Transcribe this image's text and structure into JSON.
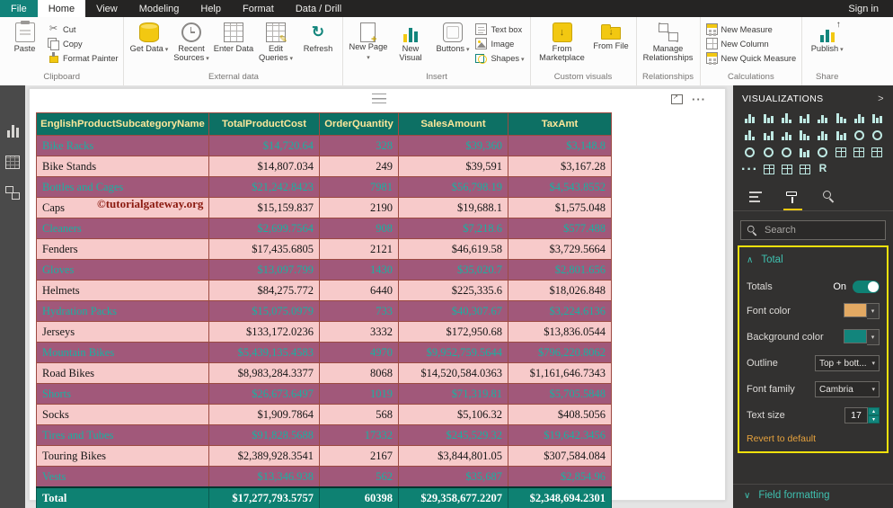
{
  "titlebar": {
    "file_tab": "File",
    "tabs": [
      "Home",
      "View",
      "Modeling",
      "Help",
      "Format",
      "Data / Drill"
    ],
    "active_tab": "Home",
    "sign_in": "Sign in"
  },
  "ribbon": {
    "groups": {
      "clipboard": {
        "label": "Clipboard",
        "paste": "Paste",
        "cut": "Cut",
        "copy": "Copy",
        "format_painter": "Format Painter"
      },
      "external_data": {
        "label": "External data",
        "get_data": "Get Data",
        "recent_sources": "Recent Sources",
        "enter_data": "Enter Data",
        "edit_queries": "Edit Queries",
        "refresh": "Refresh"
      },
      "insert": {
        "label": "Insert",
        "new_page": "New Page",
        "new_visual": "New Visual",
        "buttons": "Buttons",
        "text_box": "Text box",
        "image": "Image",
        "shapes": "Shapes"
      },
      "custom_visuals": {
        "label": "Custom visuals",
        "from_marketplace": "From Marketplace",
        "from_file": "From File"
      },
      "relationships": {
        "label": "Relationships",
        "manage_relationships": "Manage Relationships"
      },
      "calculations": {
        "label": "Calculations",
        "new_measure": "New Measure",
        "new_column": "New Column",
        "new_quick_measure": "New Quick Measure"
      },
      "share": {
        "label": "Share",
        "publish": "Publish"
      }
    }
  },
  "canvas": {
    "watermark": "©tutorialgateway.org"
  },
  "table": {
    "columns": [
      "EnglishProductSubcategoryName",
      "TotalProductCost",
      "OrderQuantity",
      "SalesAmount",
      "TaxAmt"
    ],
    "rows": [
      {
        "style": "accent",
        "cells": [
          "Bike Racks",
          "$14,720.64",
          "328",
          "$39,360",
          "$3,148.8"
        ]
      },
      {
        "style": "plain",
        "cells": [
          "Bike Stands",
          "$14,807.034",
          "249",
          "$39,591",
          "$3,167.28"
        ]
      },
      {
        "style": "accent",
        "cells": [
          "Bottles and Cages",
          "$21,242.8423",
          "7981",
          "$56,798.19",
          "$4,543.8552"
        ]
      },
      {
        "style": "plain",
        "cells": [
          "Caps",
          "$15,159.837",
          "2190",
          "$19,688.1",
          "$1,575.048"
        ]
      },
      {
        "style": "accent",
        "cells": [
          "Cleaners",
          "$2,699.7564",
          "908",
          "$7,218.6",
          "$577.488"
        ]
      },
      {
        "style": "plain",
        "cells": [
          "Fenders",
          "$17,435.6805",
          "2121",
          "$46,619.58",
          "$3,729.5664"
        ]
      },
      {
        "style": "accent",
        "cells": [
          "Gloves",
          "$13,097.799",
          "1430",
          "$35,020.7",
          "$2,801.656"
        ]
      },
      {
        "style": "plain",
        "cells": [
          "Helmets",
          "$84,275.772",
          "6440",
          "$225,335.6",
          "$18,026.848"
        ]
      },
      {
        "style": "accent",
        "cells": [
          "Hydration Packs",
          "$15,075.0979",
          "733",
          "$40,307.67",
          "$3,224.6136"
        ]
      },
      {
        "style": "plain",
        "cells": [
          "Jerseys",
          "$133,172.0236",
          "3332",
          "$172,950.68",
          "$13,836.0544"
        ]
      },
      {
        "style": "accent",
        "cells": [
          "Mountain Bikes",
          "$5,439,135.4583",
          "4970",
          "$9,952,759.5644",
          "$796,220.8062"
        ]
      },
      {
        "style": "plain",
        "cells": [
          "Road Bikes",
          "$8,983,284.3377",
          "8068",
          "$14,520,584.0363",
          "$1,161,646.7343"
        ]
      },
      {
        "style": "accent",
        "cells": [
          "Shorts",
          "$26,673.6497",
          "1019",
          "$71,319.81",
          "$5,705.5848"
        ]
      },
      {
        "style": "plain",
        "cells": [
          "Socks",
          "$1,909.7864",
          "568",
          "$5,106.32",
          "$408.5056"
        ]
      },
      {
        "style": "accent",
        "cells": [
          "Tires and Tubes",
          "$91,828.5688",
          "17332",
          "$245,529.32",
          "$19,642.3456"
        ]
      },
      {
        "style": "plain",
        "cells": [
          "Touring Bikes",
          "$2,389,928.3541",
          "2167",
          "$3,844,801.05",
          "$307,584.084"
        ]
      },
      {
        "style": "accent",
        "cells": [
          "Vests",
          "$13,346.938",
          "562",
          "$35,687",
          "$2,854.96"
        ]
      }
    ],
    "total_row": [
      "Total",
      "$17,277,793.5757",
      "60398",
      "$29,358,677.2207",
      "$2,348,694.2301"
    ]
  },
  "visualizations": {
    "title": "VISUALIZATIONS",
    "icons": [
      "stacked-bar-chart",
      "stacked-column-chart",
      "clustered-bar-chart",
      "clustered-column-chart",
      "100-stacked-bar-chart",
      "100-stacked-column-chart",
      "line-chart",
      "area-chart",
      "stacked-area-chart",
      "line-clustered-column-chart",
      "line-stacked-column-chart",
      "ribbon-chart",
      "waterfall-chart",
      "scatter-chart",
      "pie-chart",
      "donut-chart",
      "treemap",
      "map",
      "filled-map",
      "funnel",
      "gauge",
      "card",
      "multi-row-card",
      "kpi",
      "ellipsis",
      "slicer",
      "table",
      "matrix",
      "r-script"
    ],
    "tabs": [
      "fields",
      "format",
      "analytics"
    ],
    "active_tab": "format",
    "search_placeholder": "Search"
  },
  "format_panel": {
    "total_card": {
      "title": "Total",
      "totals_label": "Totals",
      "totals_state": "On",
      "font_color_label": "Font color",
      "font_color_value": "#e2a963",
      "background_color_label": "Background color",
      "background_color_value": "#12857c",
      "outline_label": "Outline",
      "outline_value": "Top + bott...",
      "font_family_label": "Font family",
      "font_family_value": "Cambria",
      "text_size_label": "Text size",
      "text_size_value": "17",
      "revert_label": "Revert to default"
    },
    "field_formatting_title": "Field formatting"
  },
  "colors": {
    "accent_row_bg": "#a1587a",
    "accent_row_text": "#18b2a2",
    "plain_row_bg": "#f7caca",
    "header_bg": "#0d7064",
    "header_text": "#fce79a",
    "total_row_bg": "#0e8172",
    "grid_border": "#9c4a42",
    "highlight": "#f2e10c"
  }
}
